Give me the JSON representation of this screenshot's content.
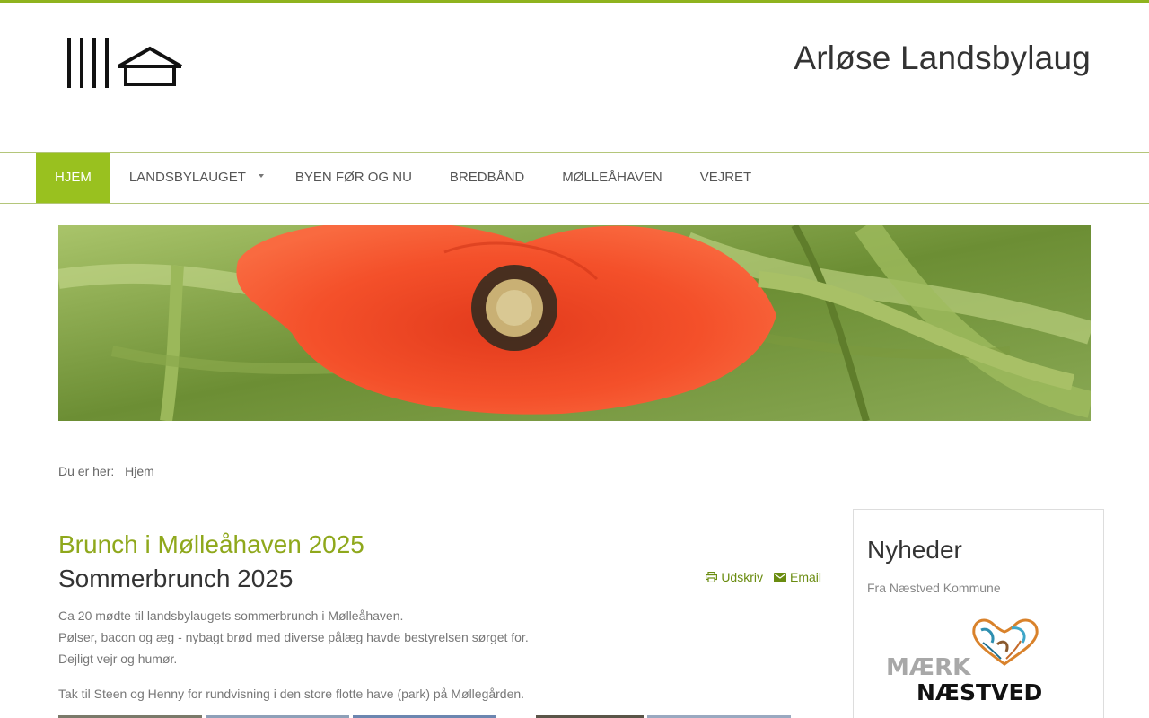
{
  "site": {
    "title": "Arløse Landsbylaug"
  },
  "nav": {
    "items": [
      {
        "label": "HJEM"
      },
      {
        "label": "LANDSBYLAUGET"
      },
      {
        "label": "BYEN FØR OG NU"
      },
      {
        "label": "BREDBÅND"
      },
      {
        "label": "MØLLEÅHAVEN"
      },
      {
        "label": "VEJRET"
      }
    ]
  },
  "breadcrumb": {
    "label": "Du er her:",
    "current": "Hjem"
  },
  "article": {
    "title": "Brunch i Mølleåhaven 2025",
    "subtitle": "Sommerbrunch 2025",
    "print_label": "Udskriv",
    "email_label": "Email",
    "paragraphs": [
      "Ca 20 mødte til landsbylaugets sommerbrunch i Mølleåhaven.",
      "Pølser, bacon og æg - nybagt brød med diverse pålæg havde bestyrelsen sørget for.",
      "Dejligt vejr og humør.",
      "Tak til Steen og Henny for rundvisning i den store flotte have (park) på Møllegården."
    ]
  },
  "sidebar": {
    "title": "Nyheder",
    "subtitle": "Fra Næstved Kommune",
    "logo_text_top": "MÆRK",
    "logo_text_bottom": "NÆSTVED"
  },
  "colors": {
    "accent": "#99c11f",
    "accent_text": "#8fa81c"
  }
}
